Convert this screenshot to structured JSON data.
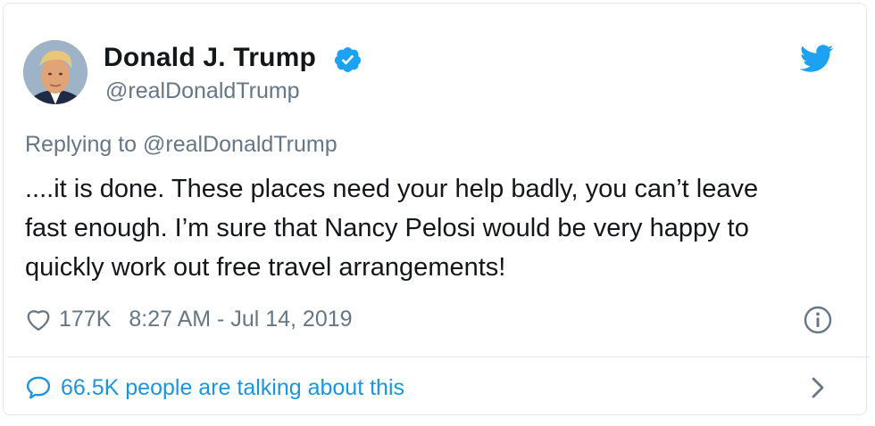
{
  "author": {
    "display_name": "Donald J. Trump",
    "handle": "@realDonaldTrump",
    "verified": true
  },
  "reply": {
    "prefix": "Replying to",
    "target": "@realDonaldTrump"
  },
  "tweet": {
    "text": "....it is done. These places need your help badly, you can’t leave\nfast enough. I’m sure that Nancy Pelosi would be very happy to\nquickly work out free travel arrangements!",
    "likes": "177K",
    "timestamp": "8:27 AM - Jul 14, 2019"
  },
  "conversation": {
    "label": "66.5K people are talking about this"
  },
  "icons": {
    "verified": "verified-badge-icon",
    "brand": "twitter-bird-icon",
    "like": "heart-outline-icon",
    "info": "info-circle-icon",
    "conversation": "speech-bubble-icon",
    "expand": "chevron-right-icon"
  },
  "colors": {
    "brand": "#1da1f2",
    "link": "#1b95e0",
    "muted": "#657786",
    "text": "#14171a",
    "border": "#e1e8ed"
  }
}
